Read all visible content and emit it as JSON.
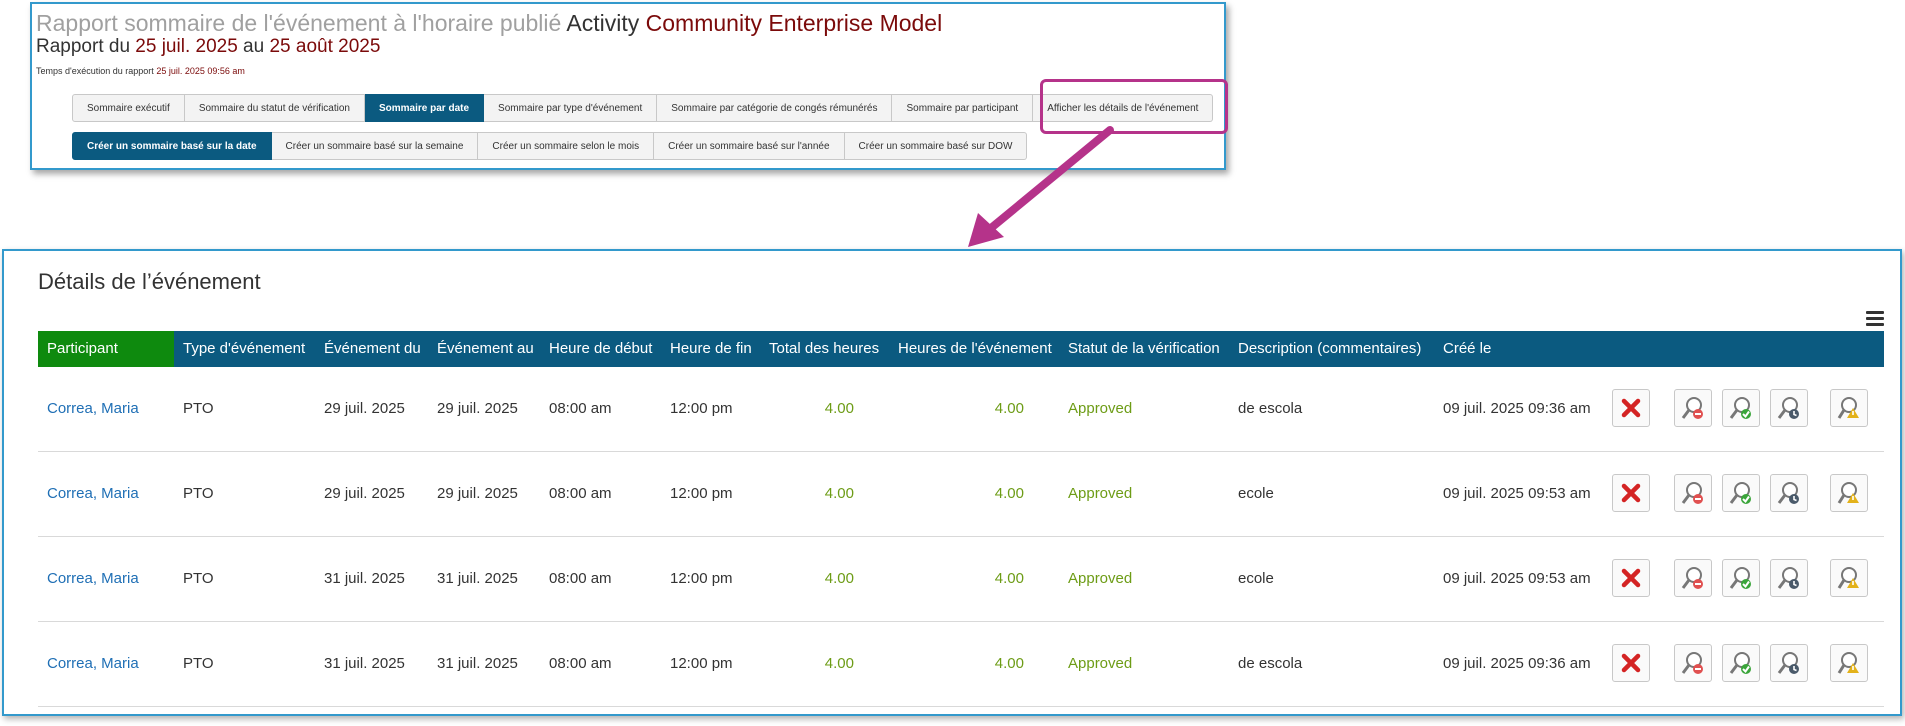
{
  "report": {
    "title_prefix": "Rapport sommaire de l'événement à l'horaire publié",
    "title_activity": "Activity",
    "title_org": "Community Enterprise Model",
    "subtitle_prefix": "Rapport du",
    "date_from": "25 juil. 2025",
    "subtitle_mid": "au",
    "date_to": "25 août 2025",
    "exec_time_label": "Temps d'exécution du rapport",
    "exec_time_value": "25 juil. 2025 09:56 am"
  },
  "tabs_row1": [
    "Sommaire exécutif",
    "Sommaire du statut de vérification",
    "Sommaire par date",
    "Sommaire par type d'événement",
    "Sommaire par catégorie de congés rémunérés",
    "Sommaire par participant",
    "Afficher les détails de l'événement"
  ],
  "tabs_row2": [
    "Créer un sommaire basé sur la date",
    "Créer un sommaire basé sur la semaine",
    "Créer un sommaire selon le mois",
    "Créer un sommaire basé sur l'année",
    "Créer un sommaire basé sur DOW"
  ],
  "details": {
    "title": "Détails de l’événement",
    "columns": [
      "Participant",
      "Type d'événement",
      "Événement du",
      "Événement au",
      "Heure de début",
      "Heure de fin",
      "Total des heures",
      "Heures de l'événement",
      "Statut de la vérification",
      "Description (commentaires)",
      "Créé le"
    ],
    "rows": [
      [
        "Correa, Maria",
        "PTO",
        "29 juil. 2025",
        "29 juil. 2025",
        "08:00 am",
        "12:00 pm",
        "4.00",
        "4.00",
        "Approved",
        "de escola",
        "09 juil. 2025 09:36 am"
      ],
      [
        "Correa, Maria",
        "PTO",
        "29 juil. 2025",
        "29 juil. 2025",
        "08:00 am",
        "12:00 pm",
        "4.00",
        "4.00",
        "Approved",
        "ecole",
        "09 juil. 2025 09:53 am"
      ],
      [
        "Correa, Maria",
        "PTO",
        "31 juil. 2025",
        "31 juil. 2025",
        "08:00 am",
        "12:00 pm",
        "4.00",
        "4.00",
        "Approved",
        "ecole",
        "09 juil. 2025 09:53 am"
      ],
      [
        "Correa, Maria",
        "PTO",
        "31 juil. 2025",
        "31 juil. 2025",
        "08:00 am",
        "12:00 pm",
        "4.00",
        "4.00",
        "Approved",
        "de escola",
        "09 juil. 2025 09:36 am"
      ]
    ],
    "row_actions": [
      "delete-icon",
      "reject-view-icon",
      "approve-view-icon",
      "pending-view-icon",
      "warning-view-icon"
    ]
  },
  "colors": {
    "header_bg": "#0b5a80",
    "participant_header_bg": "#0e8a0e",
    "link": "#1f6fb5",
    "approved": "#6d9c16",
    "highlight": "#b5338a",
    "panel_border": "#3399cc"
  }
}
